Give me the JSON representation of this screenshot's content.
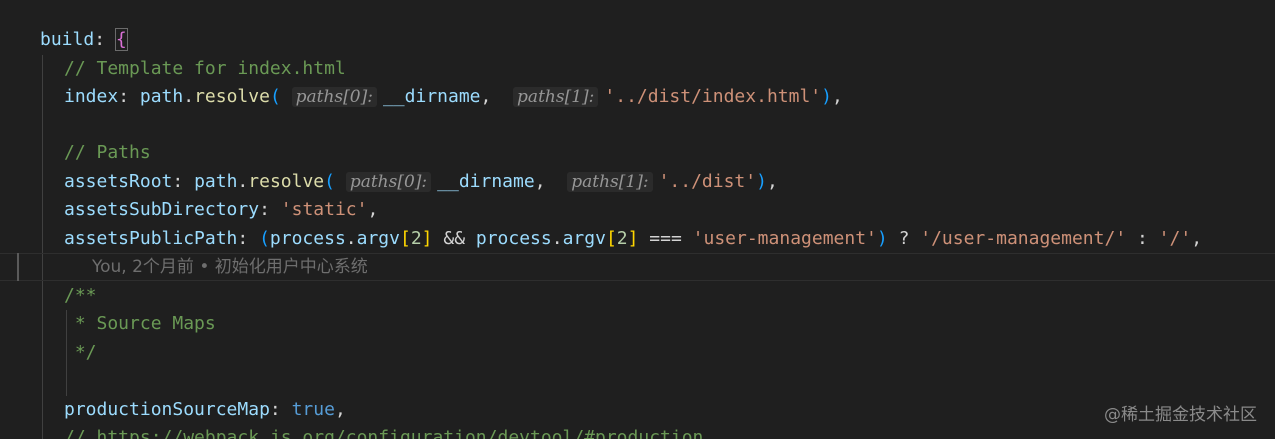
{
  "code": {
    "l1_key": "build",
    "l1_colon": ": ",
    "l1_brace": "{",
    "l2_comment": "// Template for index.html",
    "l3_key": "index",
    "l3_colon": ": ",
    "l3_obj": "path",
    "l3_fn": "resolve",
    "l3_hint0": "paths[0]:",
    "l3_arg0": "__dirname",
    "l3_hint1": "paths[1]:",
    "l3_arg1": "'../dist/index.html'",
    "l5_comment": "// Paths",
    "l6_key": "assetsRoot",
    "l6_colon": ": ",
    "l6_obj": "path",
    "l6_fn": "resolve",
    "l6_hint0": "paths[0]:",
    "l6_arg0": "__dirname",
    "l6_hint1": "paths[1]:",
    "l6_arg1": "'../dist'",
    "l7_key": "assetsSubDirectory",
    "l7_colon": ": ",
    "l7_val": "'static'",
    "l8_key": "assetsPublicPath",
    "l8_colon": ": ",
    "l8_process1": "process",
    "l8_argv1": "argv",
    "l8_idx1": "2",
    "l8_and": " && ",
    "l8_process2": "process",
    "l8_argv2": "argv",
    "l8_idx2": "2",
    "l8_eq": " === ",
    "l8_str1": "'user-management'",
    "l8_q": " ? ",
    "l8_str2": "'/user-management/'",
    "l8_c": " : ",
    "l8_str3": "'/'",
    "blame": "You, 2个月前 • 初始化用户中心系统",
    "l10": "/**",
    "l11": " * Source Maps",
    "l12": " */",
    "l14_key": "productionSourceMap",
    "l14_colon": ": ",
    "l14_val": "true",
    "l15_comment": "// https://webpack.js.org/configuration/devtool/#production"
  },
  "watermark": "@稀土掘金技术社区",
  "colors": {
    "background": "#1f1f1f",
    "keyword": "#569cd6",
    "property": "#9cdcfe",
    "function": "#dcdcaa",
    "string": "#ce9178",
    "comment": "#6a9955"
  }
}
